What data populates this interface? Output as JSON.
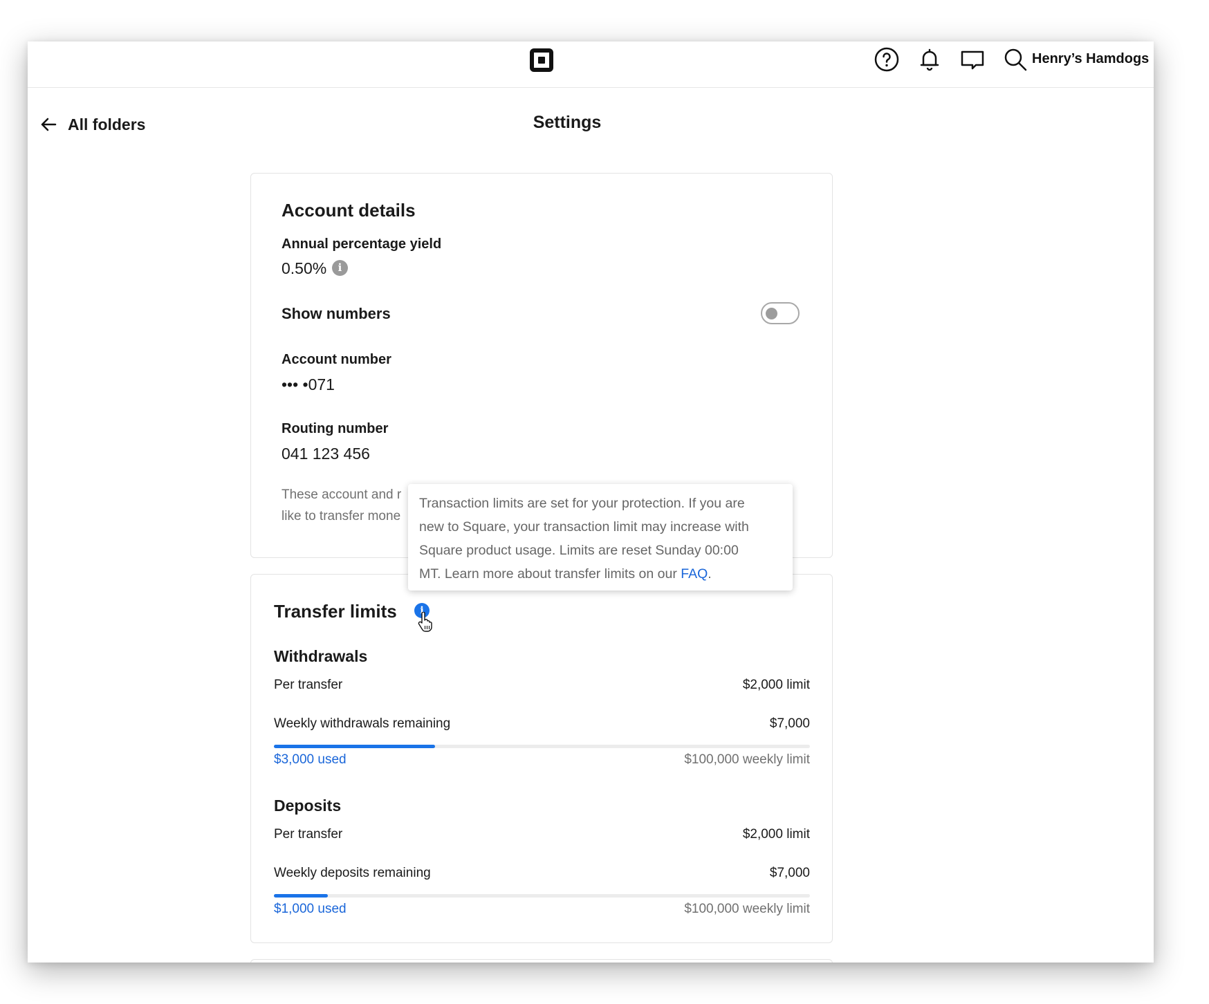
{
  "header": {
    "merchant_name": "Henry’s Hamdogs",
    "icons": [
      "square-logo-icon",
      "help-icon",
      "bell-icon",
      "message-icon",
      "search-icon"
    ]
  },
  "nav": {
    "back_label": "All folders"
  },
  "page": {
    "title": "Settings"
  },
  "account_details": {
    "heading": "Account details",
    "apy_label": "Annual percentage yield",
    "apy_value": "0.50%",
    "show_numbers_label": "Show numbers",
    "show_numbers_on": false,
    "account_number_label": "Account number",
    "account_number_value": "••• •071",
    "routing_number_label": "Routing number",
    "routing_number_value": "041 123 456",
    "disclaimer_line1": "These account and r",
    "disclaimer_line2": "like to transfer mone"
  },
  "tooltip": {
    "line1": "Transaction limits are set for your protection. If you are",
    "line2": "new to Square, your transaction limit may increase with",
    "line3": "Square product usage. Limits are reset Sunday 00:00",
    "line4": "MT.  Learn more about transfer limits on our ",
    "link": "FAQ",
    "end": "."
  },
  "transfer_limits": {
    "heading": "Transfer limits",
    "withdrawals": {
      "heading": "Withdrawals",
      "per_transfer_label": "Per transfer",
      "per_transfer_value": "$2,000 limit",
      "weekly_label": "Weekly withdrawals remaining",
      "weekly_value": "$7,000",
      "used_label": "$3,000 used",
      "weekly_limit": "$100,000 weekly limit",
      "progress_fraction": 0.3
    },
    "deposits": {
      "heading": "Deposits",
      "per_transfer_label": "Per transfer",
      "per_transfer_value": "$2,000 limit",
      "weekly_label": "Weekly deposits remaining",
      "weekly_value": "$7,000",
      "used_label": "$1,000 used",
      "weekly_limit": "$100,000 weekly limit",
      "progress_fraction": 0.1
    }
  },
  "colors": {
    "accent": "#1a73e8",
    "link": "#1a66d9",
    "muted_text": "#707070"
  }
}
